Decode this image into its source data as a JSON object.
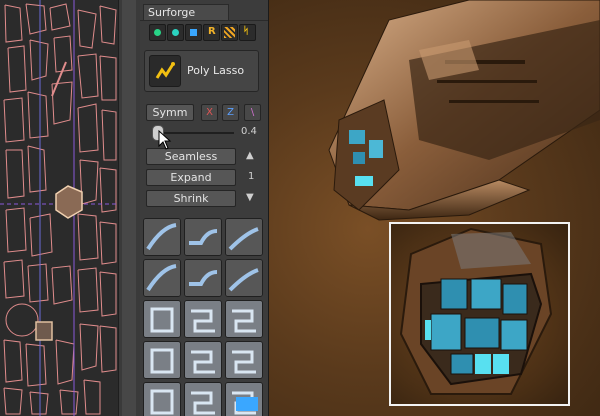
{
  "panel": {
    "tab_title": "Surforge",
    "tool_icons": [
      "green-sphere-icon",
      "cyan-sphere-icon",
      "blue-cube-icon",
      "r-icon",
      "hatch-icon",
      "spark-icon"
    ],
    "r_glyph": "R",
    "poly_lasso_label": "Poly Lasso",
    "symm_label": "Symm",
    "axis_x": "X",
    "axis_z": "Z",
    "axis_diag": "\\",
    "slider_value": "0.4",
    "slider_level": 0.04,
    "seamless_label": "Seamless",
    "expand_label": "Expand",
    "shrink_label": "Shrink",
    "up_arrow": "▲",
    "down_arrow": "▼",
    "expand_count": "1"
  },
  "colors": {
    "accent_green": "#28d487",
    "accent_blue": "#3aa7ff",
    "accent_orange": "#f0a522",
    "axis_x": "#e05555",
    "axis_z": "#5aa0ff",
    "axis_diag": "#d070d0",
    "uv_lines": "#e08c8c",
    "zoom_frame": "#f3f3f3"
  }
}
